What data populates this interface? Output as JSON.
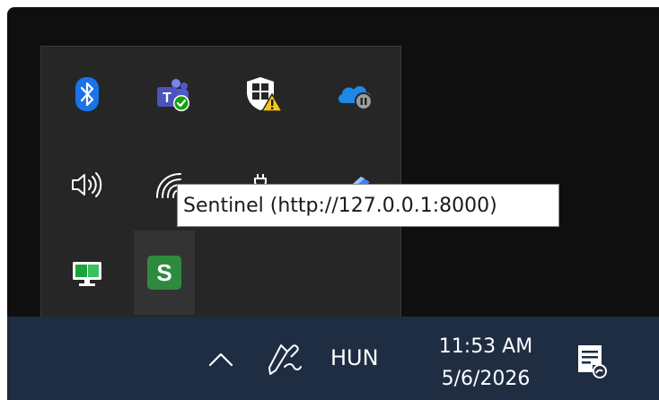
{
  "tray_overflow": {
    "icons": [
      {
        "name": "bluetooth-icon"
      },
      {
        "name": "teams-icon"
      },
      {
        "name": "windows-security-icon"
      },
      {
        "name": "onedrive-paused-icon"
      },
      {
        "name": "volume-icon"
      },
      {
        "name": "wifi-icon"
      },
      {
        "name": "battery-plugged-icon"
      },
      {
        "name": "app-blue-icon"
      },
      {
        "name": "network-display-icon"
      },
      {
        "name": "sentinel-icon",
        "glyph": "S",
        "color": "#2e8b3e"
      }
    ],
    "tooltip": "Sentinel (http://127.0.0.1:8000)"
  },
  "taskbar": {
    "language": "HUN",
    "time": "11:53 AM",
    "date": "5/6/2026",
    "chevron_icon": "chevron-up-icon",
    "pen_icon": "pen-icon",
    "notification_icon": "notification-center-icon"
  },
  "colors": {
    "taskbar_bg": "#1e2d42",
    "flyout_bg": "#262626",
    "desktop_bg": "#0f0f0f",
    "sentinel_green": "#2e8b3e",
    "bluetooth_blue": "#1a73e8"
  }
}
